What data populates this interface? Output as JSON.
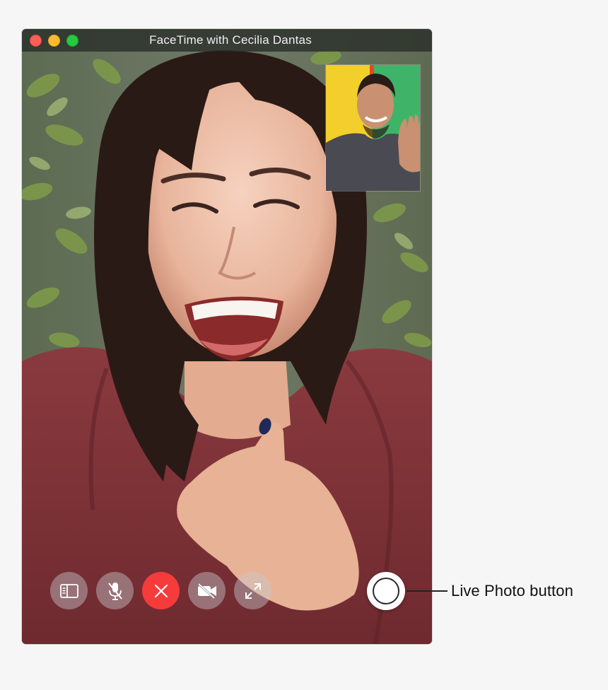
{
  "window": {
    "title": "FaceTime with Cecilia Dantas",
    "traffic_lights": [
      "close-icon",
      "minimize-icon",
      "zoom-icon"
    ]
  },
  "controls": [
    {
      "name": "sidebar-button",
      "icon": "sidebar-icon"
    },
    {
      "name": "mute-button",
      "icon": "microphone-slash-icon"
    },
    {
      "name": "end-call-button",
      "icon": "x-icon"
    },
    {
      "name": "video-off-button",
      "icon": "camera-slash-icon"
    },
    {
      "name": "full-screen-button",
      "icon": "expand-arrows-icon"
    }
  ],
  "live_photo": {
    "icon": "shutter-icon"
  },
  "callout": {
    "label": "Live Photo button"
  },
  "colors": {
    "end_call": "#f63b3b",
    "close": "#fc5f57",
    "minimize": "#fdbc2f",
    "zoom": "#28c840"
  }
}
